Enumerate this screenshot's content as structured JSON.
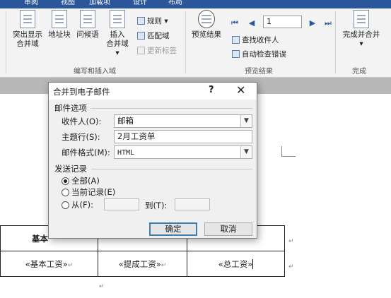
{
  "ribbon": {
    "tabs": [
      "审阅",
      "视图",
      "加载项",
      "设计",
      "布局"
    ],
    "write_insert": {
      "highlight_merge_fields": "突出显示\n合并域",
      "address_block": "地址块",
      "greeting_line": "问候语",
      "insert_merge_field": "插入\n合并域 ▾",
      "rules": "规则 ▾",
      "match_fields": "匹配域",
      "update_labels": "更新标签",
      "group_label": "编写和插入域"
    },
    "preview": {
      "preview_results": "预览结果",
      "record_number": "1",
      "find_recipient": "查找收件人",
      "auto_check_errors": "自动检查错误",
      "group_label": "预览结果"
    },
    "finish": {
      "finish_merge": "完成并合并",
      "finish_merge_arrow": "▾",
      "group_label": "完成"
    }
  },
  "dialog": {
    "title": "合并到电子邮件",
    "help": "?",
    "close": "✕",
    "message_options_label": "邮件选项",
    "to_label": "收件人(O):",
    "to_value": "邮箱",
    "subject_label": "主题行(S):",
    "subject_value": "2月工资单",
    "format_label": "邮件格式(M):",
    "format_value": "HTML",
    "send_records_label": "发送记录",
    "radio_all": "全部(A)",
    "radio_current": "当前记录(E)",
    "radio_from": "从(F):",
    "to_range_label": "到(T):",
    "ok": "确定",
    "cancel": "取消"
  },
  "document": {
    "header_cell": "基本",
    "field_base_salary": "«基本工资»",
    "field_commission": "«提成工资»",
    "field_total_salary": "«总工资»",
    "para_mark": "↵"
  }
}
